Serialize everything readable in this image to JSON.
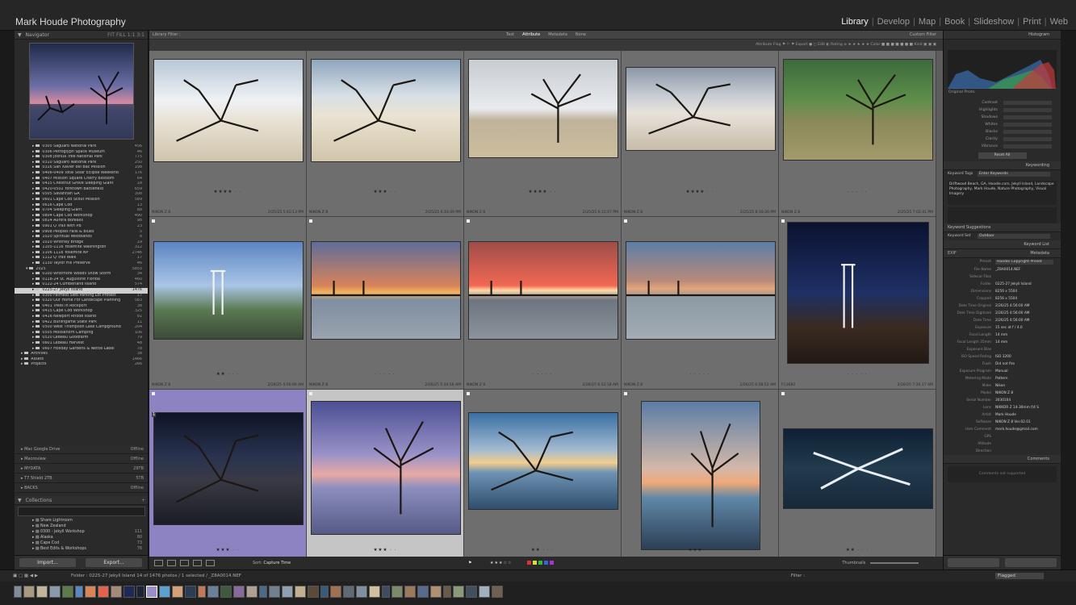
{
  "app": {
    "identity_plate": "Mark Houde Photography",
    "modules": [
      {
        "label": "Library",
        "active": true
      },
      {
        "label": "Develop",
        "active": false
      },
      {
        "label": "Map",
        "active": false
      },
      {
        "label": "Book",
        "active": false
      },
      {
        "label": "Slideshow",
        "active": false
      },
      {
        "label": "Print",
        "active": false
      },
      {
        "label": "Web",
        "active": false
      }
    ]
  },
  "left_panel": {
    "navigator_label": "Navigator",
    "navigator_zoom": "FIT  FILL  1:1  3:1",
    "folders": [
      {
        "label": "0305 Saguaro National Park",
        "count": "456"
      },
      {
        "label": "0306 Petroglyph Space Museum",
        "count": "46"
      },
      {
        "label": "0308 Joshua Tree National Park",
        "count": "775"
      },
      {
        "label": "0310 Saguaro National Park",
        "count": "250"
      },
      {
        "label": "0316 San Xavier del Bac Mission",
        "count": "198"
      },
      {
        "label": "0406-0409 Total Solar Eclipse Weekend",
        "count": "176"
      },
      {
        "label": "0407 Mission Square Cherry Blossom",
        "count": "64"
      },
      {
        "label": "0415 Chestnut Grove Sleeping Giant",
        "count": "18"
      },
      {
        "label": "0420-0502 Yorktown Battlefield",
        "count": "659"
      },
      {
        "label": "0505 Savannah GA",
        "count": "308"
      },
      {
        "label": "0601 Cape Cod Scout Mission",
        "count": "589"
      },
      {
        "label": "0616 Cape Cod",
        "count": "13"
      },
      {
        "label": "0704 Sleeping Giant",
        "count": "88"
      },
      {
        "label": "0804 Cape Cod Workshop",
        "count": "490"
      },
      {
        "label": "0814 Aurora Borealis",
        "count": "98"
      },
      {
        "label": "0901 Q Trail with PB",
        "count": "23"
      },
      {
        "label": "0908 Peoples Falls & Blues",
        "count": "5"
      },
      {
        "label": "1020 Spiritual Woodlands",
        "count": "8"
      },
      {
        "label": "1020 Whitney Bridge",
        "count": "19"
      },
      {
        "label": "1105-1116 Yosemite Washington",
        "count": "312"
      },
      {
        "label": "1106 1118 Yosemite NP",
        "count": "2746"
      },
      {
        "label": "1112 Q Trail Walk",
        "count": "17"
      },
      {
        "label": "1130 Taylor Hill Preserve",
        "count": "46"
      }
    ],
    "folder_2025": {
      "label": "2025",
      "count": "5853"
    },
    "folders_2025": [
      {
        "label": "0100 Whitmore Woods Snow Storm",
        "count": "34"
      },
      {
        "label": "0118-24 St. Augustine Florida",
        "count": "460"
      },
      {
        "label": "0122-24 Cumberland Island",
        "count": "574"
      },
      {
        "label": "0225-27 Jekyll Island",
        "count": "1476",
        "selected": true
      },
      {
        "label": "0300 Fairfield Sled Parking Lot Protest",
        "count": "17"
      },
      {
        "label": "0320 Our Home For Landscape Planning",
        "count": "583"
      },
      {
        "label": "0401 Trees In Rockport",
        "count": "38"
      },
      {
        "label": "0415 Cape Cod Workshop",
        "count": "325"
      },
      {
        "label": "0416 Newport Rhode Island",
        "count": "81"
      },
      {
        "label": "0422 Burlingame State Park",
        "count": "11"
      },
      {
        "label": "0500 West Thompson Lake Campground",
        "count": "204"
      },
      {
        "label": "0505 Moosehorn Camping",
        "count": "106"
      },
      {
        "label": "0520 LeBeau Goodfarm",
        "count": "79"
      },
      {
        "label": "0601 LeBeau Harvest",
        "count": "48"
      },
      {
        "label": "0607 Holiday Gardens & Nettle Label",
        "count": "78"
      }
    ],
    "roots": [
      {
        "label": "Archives",
        "count": "38"
      },
      {
        "label": "Assets",
        "count": "1466"
      },
      {
        "label": "Projects",
        "count": "266"
      }
    ],
    "sections": [
      {
        "label": "Mac Google Drive",
        "opts": "Offline"
      },
      {
        "label": "Macroview",
        "opts": "Offline"
      },
      {
        "label": "MYDATA",
        "opts": "29TB"
      },
      {
        "label": "T7 Shield 2TB",
        "opts": "5TB"
      },
      {
        "label": "BACKS",
        "opts": "Offline"
      }
    ],
    "collections_label": "Collections",
    "collections": [
      {
        "label": "Share Lightroom",
        "count": ""
      },
      {
        "label": "New Zealand",
        "count": ""
      },
      {
        "label": "0300 - Jekyll Workshop",
        "count": "111"
      },
      {
        "label": "Alaska",
        "count": "80"
      },
      {
        "label": "Cape Cod",
        "count": "73"
      },
      {
        "label": "Best Edits & Workshops",
        "count": "76"
      }
    ],
    "import_label": "Import...",
    "export_label": "Export..."
  },
  "filter_bar": {
    "crumb": "Library Filter :",
    "tabs": [
      {
        "label": "Text",
        "on": false
      },
      {
        "label": "Attribute",
        "on": true
      },
      {
        "label": "Metadata",
        "on": false
      },
      {
        "label": "None",
        "on": false
      }
    ],
    "preset": "Custom Filter",
    "attribute_line": "Attribute   Flag   ⚑   ⚐   ⚑     Export  ●  ○     Edit    ◐      Rating  ≥  ★ ★ ★ ★ ★     Color  ■ ■ ■ ■ ■ ■ ■     Kind  ▣ ▣ ▣"
  },
  "grid": {
    "cells": [
      {
        "name": "cell-driftwood-1",
        "stars": "★★★★ · ·",
        "cap_l": "",
        "cap_r": ""
      },
      {
        "name": "cell-driftwood-2",
        "stars": "★★★ · ·",
        "cap_l": "",
        "cap_r": ""
      },
      {
        "name": "cell-lone-tree",
        "stars": "★★★★ · ·",
        "cap_l": "",
        "cap_r": ""
      },
      {
        "name": "cell-beach-driftwood",
        "stars": "★★★★ · ·",
        "cap_l": "",
        "cap_r": ""
      },
      {
        "name": "cell-marsh-palms",
        "stars": "· · · · ·",
        "cap_l": "",
        "cap_r": ""
      },
      {
        "name": "cell-lighthouse-day",
        "stars": "★★ · · ·",
        "cap_l": "NIKON Z 8",
        "cap_r": "2/25/25 5:42:13 PM"
      },
      {
        "name": "cell-sunset-bridge-1",
        "stars": "· · · · ·",
        "cap_l": "NIKON Z 8",
        "cap_r": "2/25/25 6:10:49 PM"
      },
      {
        "name": "cell-sunset-bridge-2",
        "stars": "· · · · ·",
        "cap_l": "NIKON Z 8",
        "cap_r": "2/25/25 6:15:07 PM"
      },
      {
        "name": "cell-sunset-bridge-3",
        "stars": "· · · · ·",
        "cap_l": "NIKON Z 8",
        "cap_r": "2/25/25 6:18:26 PM"
      },
      {
        "name": "cell-lighthouse-night",
        "stars": "· · · · ·",
        "cap_l": "NIKON Z 8",
        "cap_r": "2/25/25 7:02:41 PM"
      },
      {
        "name": "cell-milky-way",
        "stars": "★★★ · ·",
        "cap_l": "NIKON Z 8",
        "cap_r": "2/26/25 4:56:00 AM"
      },
      {
        "name": "cell-sunrise-trees",
        "stars": "★★★ · ·",
        "cap_l": "NIKON Z 8",
        "cap_r": "2/26/25 5:34:56 AM"
      },
      {
        "name": "cell-sunrise-driftwood",
        "stars": "★★ · · ·",
        "cap_l": "NIKON Z 8",
        "cap_r": "2/26/25 6:52:18 AM"
      },
      {
        "name": "cell-sunrise-vertical",
        "stars": "★★★ · ·",
        "cap_l": "NIKON Z 8",
        "cap_r": "2/26/25 6:58:52 AM"
      },
      {
        "name": "cell-aerial-tree",
        "stars": "★★ · · ·",
        "cap_l": "FC3682",
        "cap_r": "2/26/25 7:30:17 AM"
      }
    ],
    "selected_number": "1"
  },
  "toolbar": {
    "sort_label": "Sort:",
    "sort_value": "Capture Time",
    "thumbnails_label": "Thumbnails"
  },
  "right_panel": {
    "histogram_label": "Histogram",
    "original_photo": "Original Photo",
    "quick_develop": [
      "Contrast",
      "Highlights",
      "Shadows",
      "Whites",
      "Blacks",
      "Clarity",
      "Vibrance"
    ],
    "reset_all": "Reset All",
    "keywording_label": "Keywording",
    "keyword_tags_label": "Keyword Tags",
    "keyword_tags_value": "Enter Keywords",
    "keywords_text": "Driftwood Beach, GA, Hoodie.com, Jekyll Island, Landscape Photography, Mark Houde, Nature Photography, Visual Imagery",
    "keyword_suggestions": "Keyword Suggestions",
    "keyword_set_label": "Keyword Set",
    "keyword_set_value": "Outdoor",
    "keyword_list_label": "Keyword List",
    "metadata_label": "Metadata",
    "metadata_preset_label": "Preset",
    "metadata_preset_value": "Hoodie Copyright Preset",
    "metadata": [
      {
        "k": "File Name",
        "v": "_Z8A0014.NEF"
      },
      {
        "k": "Sidecar Files",
        "v": ""
      },
      {
        "k": "Folder",
        "v": "0225-27 Jekyll Island"
      },
      {
        "k": "Dimensions",
        "v": "8256 x 5504"
      },
      {
        "k": "Cropped",
        "v": "8256 x 5504"
      },
      {
        "k": "Date Time Original",
        "v": "2/26/25 4:56:00 AM"
      },
      {
        "k": "Date Time Digitized",
        "v": "2/26/25 4:56:00 AM"
      },
      {
        "k": "Date Time",
        "v": "2/26/25 4:56:00 AM"
      },
      {
        "k": "Exposure",
        "v": "15 sec at f / 4.0"
      },
      {
        "k": "Focal Length",
        "v": "14 mm"
      },
      {
        "k": "Focal Length 35mm",
        "v": "14 mm"
      },
      {
        "k": "Exposure Bias",
        "v": ""
      },
      {
        "k": "ISO Speed Rating",
        "v": "ISO 3200"
      },
      {
        "k": "Flash",
        "v": "Did not fire"
      },
      {
        "k": "Exposure Program",
        "v": "Manual"
      },
      {
        "k": "Metering Mode",
        "v": "Pattern"
      },
      {
        "k": "Make",
        "v": "Nikon"
      },
      {
        "k": "Model",
        "v": "NIKON Z 8"
      },
      {
        "k": "Serial Number",
        "v": "3030104"
      },
      {
        "k": "Lens",
        "v": "NIKKOR Z 14-30mm f/4 S"
      },
      {
        "k": "Artist",
        "v": "Mark Houde"
      },
      {
        "k": "Software",
        "v": "NIKON Z 8 Ver.02.01"
      },
      {
        "k": "User Comment",
        "v": "mark.houde@gmail.com"
      },
      {
        "k": "GPS",
        "v": ""
      },
      {
        "k": "Altitude",
        "v": ""
      },
      {
        "k": "Direction",
        "v": ""
      }
    ],
    "comments_label": "Comments",
    "comments_placeholder": "Comments not supported"
  },
  "filmstrip": {
    "path": "Folder : 0225-27 Jekyll Island     14 of 1476 photos / 1 selected / _Z8A0014.NEF",
    "filter_label": "Filter :",
    "filter_value": "Flagged"
  },
  "colors": {
    "accent_purple": "#8e83c2",
    "background": "#1a1a1a",
    "grid_bg": "#5d5d5d"
  }
}
